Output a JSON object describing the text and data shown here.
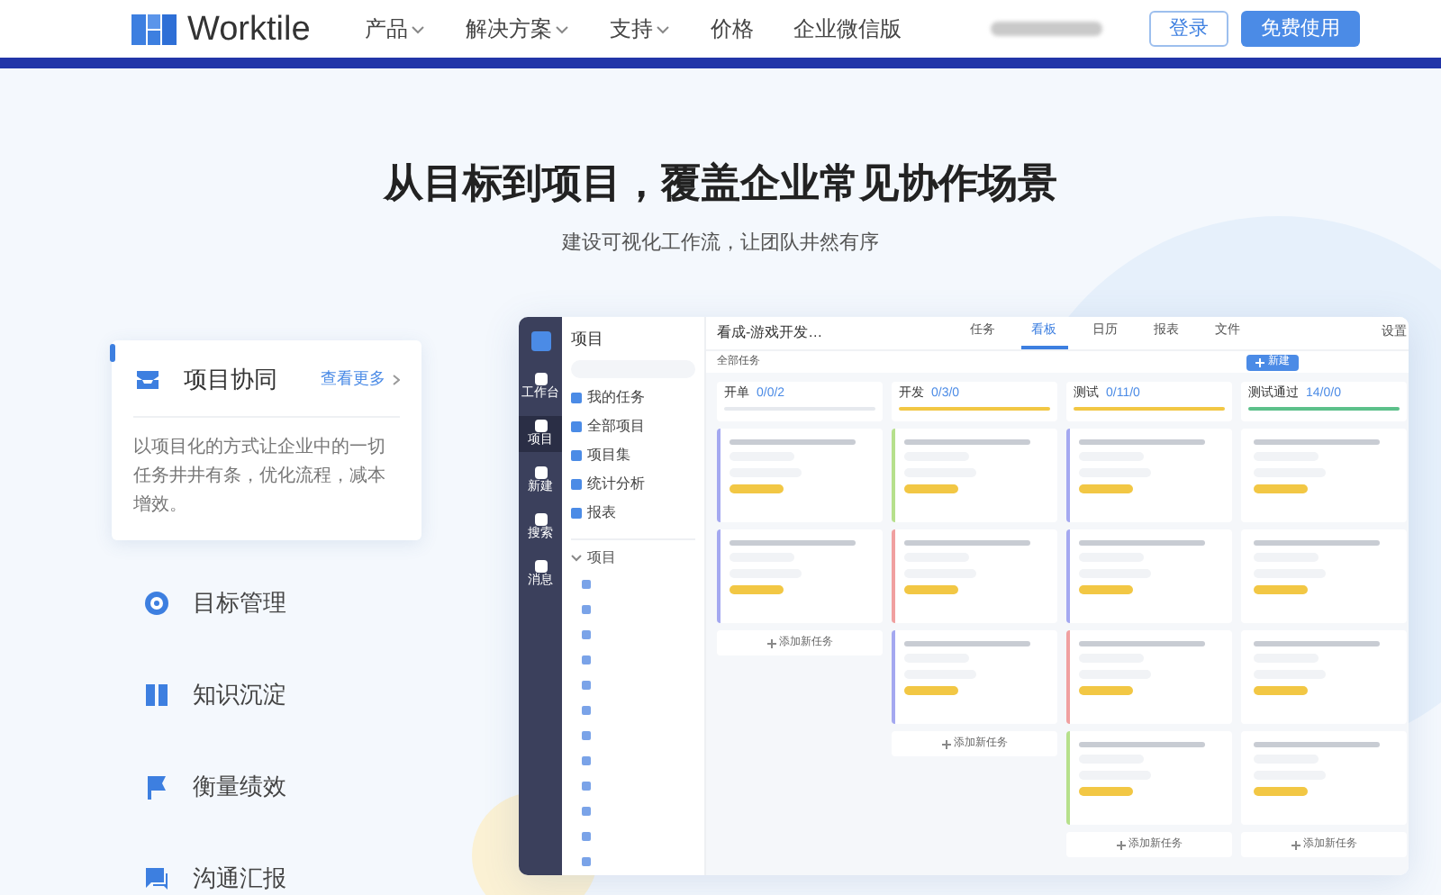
{
  "nav": {
    "logo": "Worktile",
    "menu": [
      {
        "label": "产品",
        "dropdown": true
      },
      {
        "label": "解决方案",
        "dropdown": true
      },
      {
        "label": "支持",
        "dropdown": true
      },
      {
        "label": "价格",
        "dropdown": false
      },
      {
        "label": "企业微信版",
        "dropdown": false
      }
    ],
    "login": "登录",
    "signup": "免费使用"
  },
  "hero": {
    "title": "从目标到项目，覆盖企业常见协作场景",
    "subtitle": "建设可视化工作流，让团队井然有序"
  },
  "features": [
    {
      "label": "项目协同",
      "selected": true,
      "link": "查看更多",
      "description": "以项目化的方式让企业中的一切任务井井有条，优化流程，减本增效。"
    },
    {
      "label": "目标管理",
      "selected": false
    },
    {
      "label": "知识沉淀",
      "selected": false
    },
    {
      "label": "衡量绩效",
      "selected": false
    },
    {
      "label": "沟通汇报",
      "selected": false
    }
  ],
  "app": {
    "rail": [
      {
        "label": "工作台",
        "selected": false
      },
      {
        "label": "项目",
        "selected": true
      },
      {
        "label": "新建",
        "selected": false
      },
      {
        "label": "搜索",
        "selected": false
      },
      {
        "label": "消息",
        "selected": false
      }
    ],
    "panel": {
      "title": "项目",
      "items": [
        "我的任务",
        "全部项目",
        "项目集",
        "统计分析",
        "报表"
      ],
      "group": "项目"
    },
    "board": {
      "title": "看成-游戏开发…",
      "filter": "全部任务",
      "tabs": [
        {
          "label": "任务",
          "selected": false
        },
        {
          "label": "看板",
          "selected": true
        },
        {
          "label": "日历",
          "selected": false
        },
        {
          "label": "报表",
          "selected": false
        },
        {
          "label": "文件",
          "selected": false
        }
      ],
      "settings": "设置",
      "new_button": "新建",
      "columns": [
        {
          "name": "开单",
          "count": "0/0/2",
          "add_task": "添加新任务",
          "cards": [
            {
              "color": "#a4a8f0"
            },
            {
              "color": "#a4a8f0"
            }
          ]
        },
        {
          "name": "开发",
          "count": "0/3/0",
          "add_task": "添加新任务",
          "cards": [
            {
              "color": "#b6e08c"
            },
            {
              "color": "#f0a0a0"
            },
            {
              "color": "#a4a8f0"
            }
          ]
        },
        {
          "name": "测试",
          "count": "0/11/0",
          "add_task": "添加新任务",
          "cards": [
            {
              "color": "#a4a8f0"
            },
            {
              "color": "#a4a8f0"
            },
            {
              "color": "#f0a0a0"
            },
            {
              "color": "#b6e08c"
            }
          ]
        },
        {
          "name": "测试通过",
          "count": "14/0/0",
          "add_task": "添加新任务",
          "cards": [
            {
              "color": "#ffffff"
            },
            {
              "color": "#ffffff"
            },
            {
              "color": "#ffffff"
            },
            {
              "color": "#ffffff"
            }
          ]
        }
      ]
    }
  }
}
